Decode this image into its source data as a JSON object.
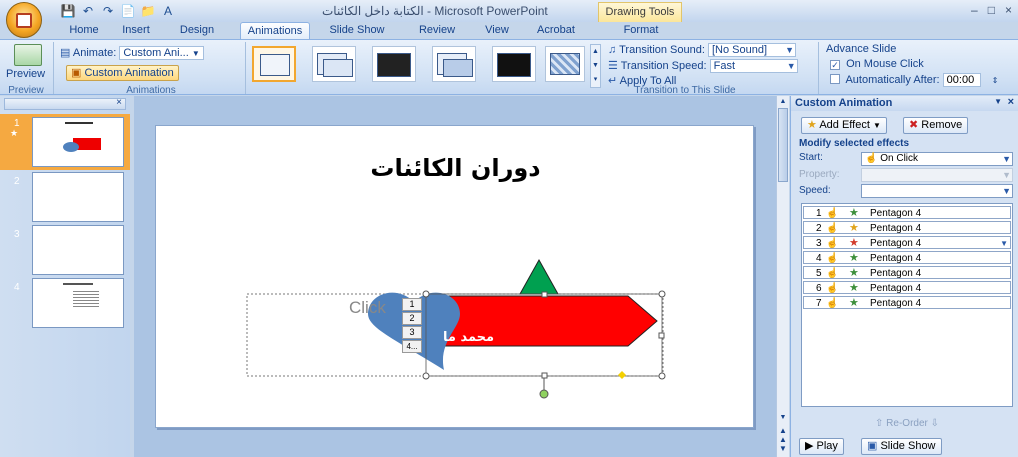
{
  "title_bar": {
    "title": "الكتابة داخل الكائنات - Microsoft PowerPoint",
    "contextual_tab_group": "Drawing Tools"
  },
  "tabs": [
    "Home",
    "Insert",
    "Design",
    "Animations",
    "Slide Show",
    "Review",
    "View",
    "Acrobat",
    "Format"
  ],
  "active_tab": "Animations",
  "ribbon": {
    "preview": {
      "button": "Preview",
      "group": "Preview"
    },
    "animations": {
      "animate_label": "Animate:",
      "animate_value": "Custom Ani...",
      "custom_animation": "Custom Animation",
      "group": "Animations"
    },
    "transition": {
      "sound_label": "Transition Sound:",
      "sound_value": "[No Sound]",
      "speed_label": "Transition Speed:",
      "speed_value": "Fast",
      "apply_all": "Apply To All",
      "group": "Transition to This Slide"
    },
    "advance": {
      "title": "Advance Slide",
      "on_mouse_click": "On Mouse Click",
      "on_mouse_click_checked": true,
      "auto_after": "Automatically After:",
      "auto_after_checked": false,
      "time": "00:00"
    }
  },
  "slides": [
    {
      "number": "1",
      "selected": true
    },
    {
      "number": "2",
      "selected": false
    },
    {
      "number": "3",
      "selected": false
    },
    {
      "number": "4",
      "selected": false
    }
  ],
  "slide": {
    "title": "دوران الكائنات",
    "placeholder_text": "Click",
    "shape_text": "محمد ما",
    "anim_tags": [
      "1",
      "2",
      "3",
      "4..."
    ]
  },
  "custom_animation_pane": {
    "title": "Custom Animation",
    "add_effect": "Add Effect",
    "remove": "Remove",
    "modify_title": "Modify selected effects",
    "start_label": "Start:",
    "start_value": "On Click",
    "property_label": "Property:",
    "speed_label": "Speed:",
    "effects": [
      {
        "num": "1",
        "name": "Pentagon 4",
        "star_color": "#3c8f3a"
      },
      {
        "num": "2",
        "name": "Pentagon 4",
        "star_color": "#e0a41c"
      },
      {
        "num": "3",
        "name": "Pentagon 4",
        "star_color": "#d23a2a"
      },
      {
        "num": "4",
        "name": "Pentagon 4",
        "star_color": "#3c8f3a"
      },
      {
        "num": "5",
        "name": "Pentagon 4",
        "star_color": "#3c8f3a"
      },
      {
        "num": "6",
        "name": "Pentagon 4",
        "star_color": "#3c8f3a"
      },
      {
        "num": "7",
        "name": "Pentagon 4",
        "star_color": "#3c8f3a"
      }
    ],
    "reorder_label": "Re-Order",
    "play": "Play",
    "slide_show": "Slide Show"
  },
  "colors": {
    "pentagon": "#ff0000",
    "heart": "#4f81bd",
    "star": "#00a050",
    "selected_slide": "#f5a941"
  }
}
